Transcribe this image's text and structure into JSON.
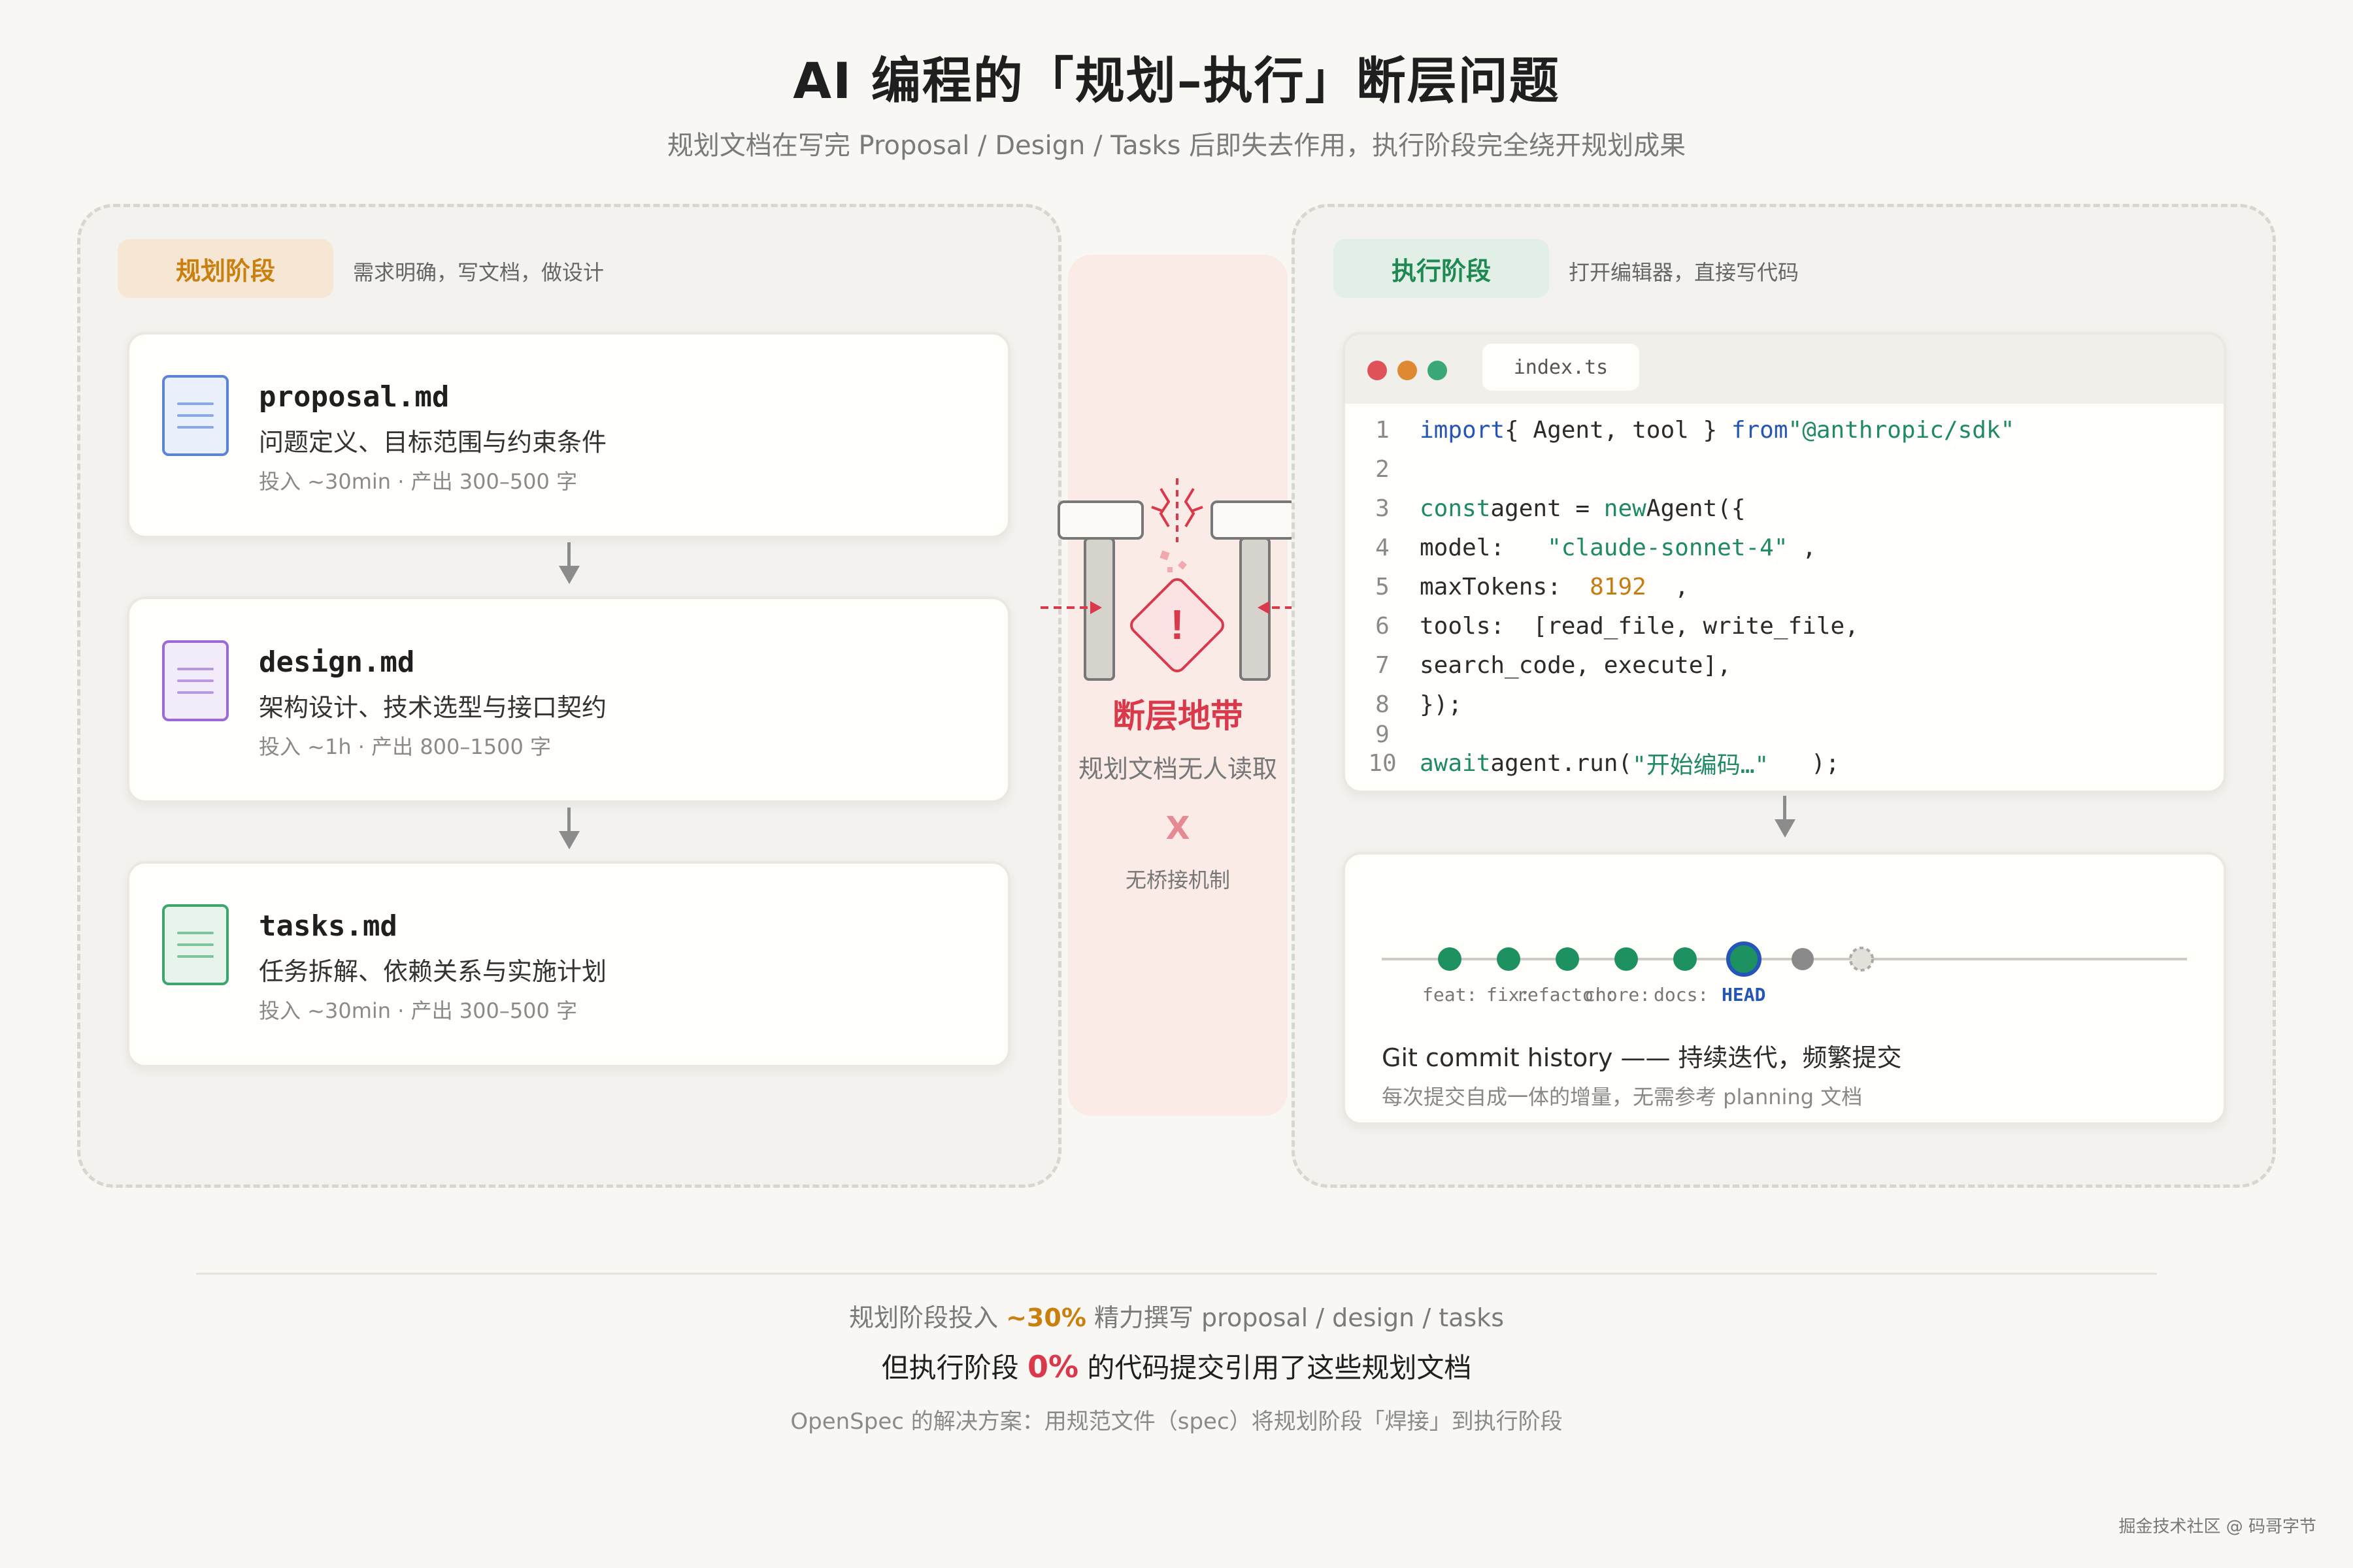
{
  "title": "AI 编程的「规划–执行」断层问题",
  "subtitle": "规划文档在写完 Proposal / Design / Tasks 后即失去作用，执行阶段完全绕开规划成果",
  "planning": {
    "tag": "规划阶段",
    "desc": "需求明确，写文档，做设计",
    "docs": [
      {
        "name": "proposal.md",
        "desc": "问题定义、目标范围与约束条件",
        "meta": "投入 ~30min · 产出 300–500 字"
      },
      {
        "name": "design.md",
        "desc": "架构设计、技术选型与接口契约",
        "meta": "投入 ~1h · 产出 800–1500 字"
      },
      {
        "name": "tasks.md",
        "desc": "任务拆解、依赖关系与实施计划",
        "meta": "投入 ~30min · 产出 300–500 字"
      }
    ]
  },
  "gap": {
    "warning_glyph": "!",
    "label": "断层地带",
    "desc": "规划文档无人读取",
    "cross": "X",
    "note": "无桥接机制"
  },
  "execution": {
    "tag": "执行阶段",
    "desc": "打开编辑器，直接写代码",
    "editor": {
      "tab": "index.ts",
      "lines": [
        {
          "n": "1",
          "parts": [
            {
              "c": "kw2",
              "t": "import"
            },
            {
              "c": "txt",
              "t": "{ Agent, tool } "
            },
            {
              "c": "kw2",
              "t": "from"
            },
            {
              "c": "str",
              "t": "\"@anthropic/sdk\""
            }
          ]
        },
        {
          "n": "2",
          "parts": []
        },
        {
          "n": "3",
          "parts": [
            {
              "c": "kw",
              "t": "const"
            },
            {
              "c": "txt",
              "t": "agent = "
            },
            {
              "c": "kw",
              "t": "new"
            },
            {
              "c": "txt",
              "t": "Agent({"
            }
          ]
        },
        {
          "n": "4",
          "parts": [
            {
              "c": "txt",
              "t": "model:   "
            },
            {
              "c": "str",
              "t": "\"claude-sonnet-4\""
            },
            {
              "c": "txt",
              "t": " ,"
            }
          ]
        },
        {
          "n": "5",
          "parts": [
            {
              "c": "txt",
              "t": "maxTokens:  "
            },
            {
              "c": "num",
              "t": "8192"
            },
            {
              "c": "txt",
              "t": "  ,"
            }
          ]
        },
        {
          "n": "6",
          "parts": [
            {
              "c": "txt",
              "t": "tools:  [read_file, write_file,"
            }
          ]
        },
        {
          "n": "7",
          "parts": [
            {
              "c": "txt",
              "t": "search_code, execute],"
            }
          ]
        },
        {
          "n": "8",
          "parts": [
            {
              "c": "txt",
              "t": "});"
            }
          ]
        },
        {
          "n": "9",
          "parts": []
        },
        {
          "n": "10",
          "parts": [
            {
              "c": "kw",
              "t": "await"
            },
            {
              "c": "txt",
              "t": "agent.run("
            },
            {
              "c": "str",
              "t": "\"开始编码…\""
            },
            {
              "c": "txt",
              "t": "   );"
            }
          ]
        }
      ]
    },
    "git": {
      "labels": [
        "feat:",
        "fix:",
        "refactor:",
        "chore:",
        "docs:"
      ],
      "head_label": "HEAD",
      "title": "Git commit history —— 持续迭代，频繁提交",
      "desc": "每次提交自成一体的增量，无需参考 planning 文档"
    }
  },
  "footer": {
    "line1_pre": "规划阶段投入 ",
    "line1_pct": "~30%",
    "line1_post": " 精力撰写 proposal / design / tasks",
    "line2_pre": "但执行阶段 ",
    "line2_pct": "0%",
    "line2_post": " 的代码提交引用了这些规划文档",
    "line3": "OpenSpec 的解决方案：用规范文件（spec）将规划阶段「焊接」到执行阶段"
  },
  "watermark": "掘金技术社区 @ 码哥字节",
  "colors": {
    "planning_accent": "#c9800f",
    "planning_tag_bg": "#f6e7d5",
    "execution_accent": "#1e8a52",
    "execution_tag_bg": "#e2efe7",
    "gap_red": "#d9394a",
    "commit_green": "#1e9160",
    "head_blue": "#2456b8"
  }
}
